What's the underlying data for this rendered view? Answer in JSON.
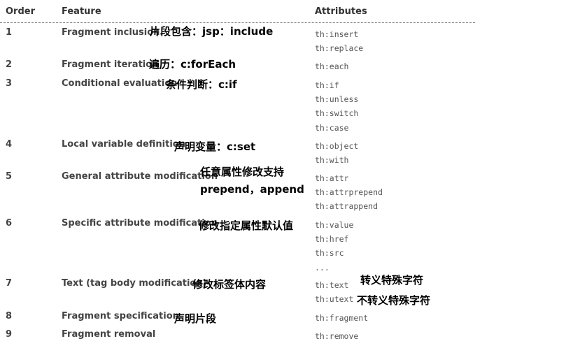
{
  "headers": {
    "order": "Order",
    "feature": "Feature",
    "attributes": "Attributes"
  },
  "rows": [
    {
      "order": "1",
      "feature": "Fragment inclusion",
      "attributes": [
        "th:insert",
        "th:replace"
      ],
      "notes": [
        "片段包含：jsp：include"
      ]
    },
    {
      "order": "2",
      "feature": "Fragment iteration",
      "attributes": [
        "th:each"
      ],
      "notes": [
        "遍历：c:forEach"
      ]
    },
    {
      "order": "3",
      "feature": "Conditional evaluation",
      "attributes": [
        "th:if",
        "th:unless",
        "th:switch",
        "th:case"
      ],
      "notes": [
        "条件判断：c:if"
      ]
    },
    {
      "order": "4",
      "feature": "Local variable definition",
      "attributes": [
        "th:object",
        "th:with"
      ],
      "notes": [
        "声明变量：c:set"
      ]
    },
    {
      "order": "5",
      "feature": "General attribute modification",
      "attributes": [
        "th:attr",
        "th:attrprepend",
        "th:attrappend"
      ],
      "notes": [
        "任意属性修改支持",
        "prepend，append"
      ]
    },
    {
      "order": "6",
      "feature": "Specific attribute modification",
      "attributes": [
        "th:value",
        "th:href",
        "th:src",
        "..."
      ],
      "notes": [
        "修改指定属性默认值"
      ]
    },
    {
      "order": "7",
      "feature": "Text (tag body modification)",
      "attributes": [
        "th:text",
        "th:utext"
      ],
      "notes": [
        "修改标签体内容"
      ],
      "attribute_notes": [
        "转义特殊字符",
        "不转义特殊字符"
      ]
    },
    {
      "order": "8",
      "feature": "Fragment specification",
      "attributes": [
        "th:fragment"
      ],
      "notes": [
        "声明片段"
      ]
    },
    {
      "order": "9",
      "feature": "Fragment removal",
      "attributes": [
        "th:remove"
      ],
      "notes": []
    }
  ]
}
